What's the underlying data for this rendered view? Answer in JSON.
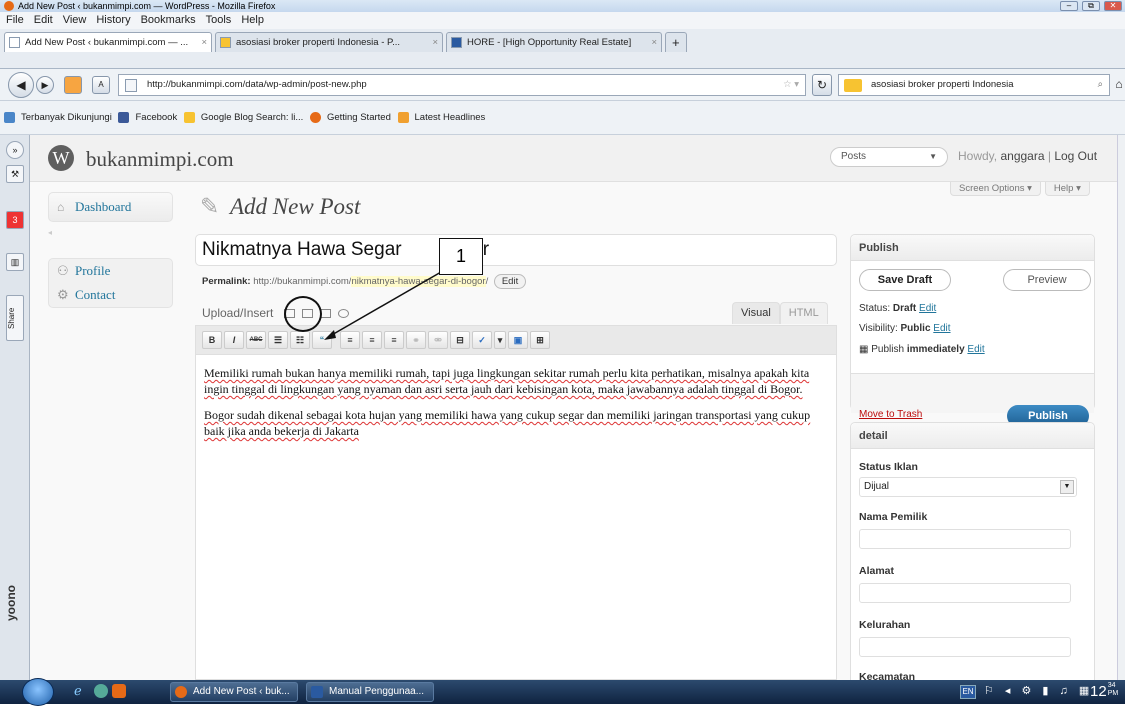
{
  "window": {
    "title": "Add New Post ‹ bukanmimpi.com — WordPress - Mozilla Firefox",
    "controls": [
      "–",
      "⧉",
      "✕"
    ]
  },
  "menubar": [
    "File",
    "Edit",
    "View",
    "History",
    "Bookmarks",
    "Tools",
    "Help"
  ],
  "tabs": [
    {
      "label": "Add New Post ‹ bukanmimpi.com — ...",
      "close": "×"
    },
    {
      "label": "asosiasi broker properti Indonesia - P...",
      "close": "×"
    },
    {
      "label": "HORE - [High Opportunity Real Estate]",
      "close": "×"
    }
  ],
  "new_tab": "+",
  "nav": {
    "url": "http://bukanmimpi.com/data/wp-admin/post-new.php",
    "search": "asosiasi broker properti Indonesia"
  },
  "bookmarks": [
    "Terbanyak Dikunjungi",
    "Facebook",
    "Google Blog Search: li...",
    "Getting Started",
    "Latest Headlines"
  ],
  "side": {
    "share": "Share",
    "yoono": "yoono"
  },
  "wp": {
    "site_name": "bukanmimpi.com",
    "posts_dropdown": "Posts",
    "howdy_prefix": "Howdy,",
    "username": "anggara",
    "separator": "|",
    "logout": "Log Out",
    "screen_options": "Screen Options ▾",
    "help": "Help ▾",
    "menu": {
      "dashboard": "Dashboard",
      "profile": "Profile",
      "contact": "Contact"
    },
    "page_title": "Add New Post",
    "post_title": "Nikmatnya Hawa Segar",
    "post_title_end": "gor",
    "permalink": {
      "label": "Permalink:",
      "base": "http://bukanmimpi.com/",
      "slug": "nikmatnya-hawa-segar-di-bogor",
      "end": "/",
      "edit": "Edit"
    },
    "upload_insert": "Upload/Insert",
    "editor_tabs": [
      "Visual",
      "HTML"
    ],
    "toolbar": [
      "B",
      "I",
      "ABC",
      "☰",
      "☷",
      "“",
      "≡",
      "≡",
      "≡",
      "⚭",
      "⚮",
      "⊟",
      "✓",
      "▾",
      "▣",
      "⊞"
    ],
    "content": [
      "Memiliki rumah bukan hanya memiliki rumah, tapi juga lingkungan sekitar rumah perlu kita perhatikan, misalnya apakah kita ingin tinggal di lingkungan yang nyaman dan asri serta jauh dari kebisingan kota, maka jawabannya adalah tinggal di Bogor.",
      "Bogor sudah dikenal sebagai kota hujan yang memiliki hawa yang cukup segar dan memiliki jaringan transportasi yang cukup baik jika anda bekerja di Jakarta"
    ],
    "publish": {
      "heading": "Publish",
      "save_draft": "Save Draft",
      "preview": "Preview",
      "status_label": "Status:",
      "status": "Draft",
      "visibility_label": "Visibility:",
      "visibility": "Public",
      "publish_label": "Publish",
      "publish_when": "immediately",
      "edit": "Edit",
      "trash": "Move to Trash",
      "publish_button": "Publish"
    },
    "detail": {
      "heading": "detail",
      "status_iklan_label": "Status Iklan",
      "status_iklan_value": "Dijual",
      "nama_pemilik": "Nama Pemilik",
      "alamat": "Alamat",
      "kelurahan": "Kelurahan",
      "kecamatan": "Kecamatan"
    }
  },
  "annotation": {
    "number": "1"
  },
  "taskbar": {
    "tasks": [
      "Add New Post ‹ buk...",
      "Manual Penggunaa..."
    ],
    "lang": "EN",
    "time": "12",
    "time_small": "34",
    "ampm": "PM"
  }
}
